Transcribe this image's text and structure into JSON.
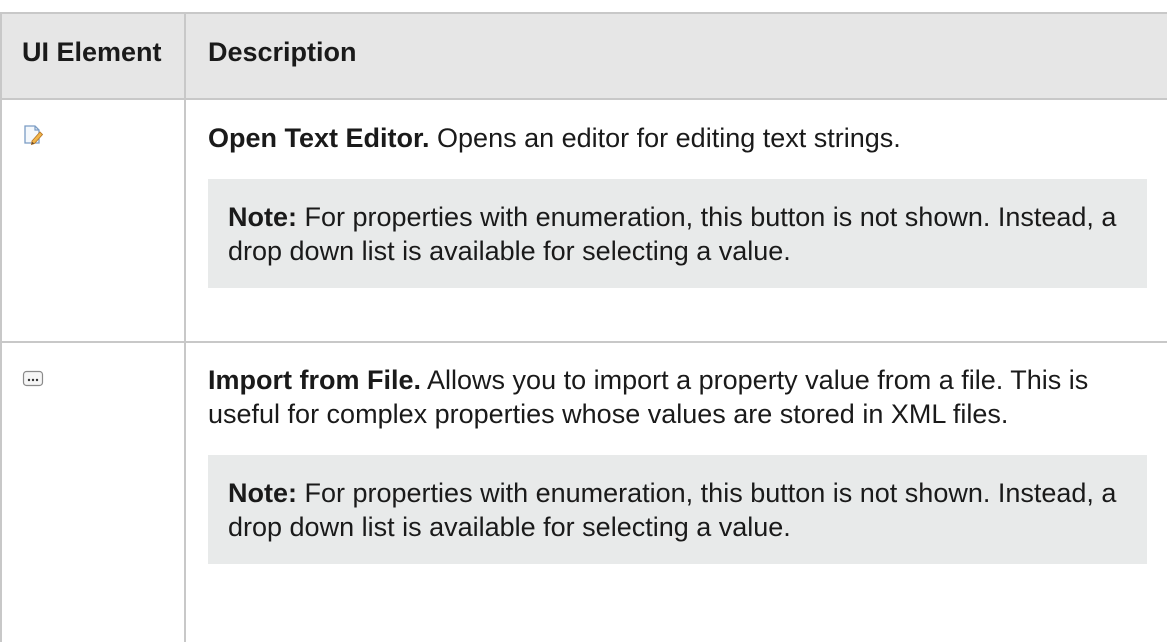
{
  "table": {
    "headers": {
      "ui_element": "UI Element",
      "description": "Description"
    },
    "rows": [
      {
        "icon": "edit-icon",
        "title": "Open Text Editor.",
        "text": " Opens an editor for editing text strings.",
        "note_label": "Note:",
        "note_text": " For properties with enumeration, this button is not shown. Instead, a drop down list is available for selecting a value."
      },
      {
        "icon": "ellipsis-icon",
        "title": "Import from File.",
        "text": " Allows you to import a property value from a file. This is useful for complex properties whose values are stored in XML files.",
        "note_label": "Note:",
        "note_text": " For properties with enumeration, this button is not shown. Instead, a drop down list is available for selecting a value."
      }
    ]
  },
  "colors": {
    "header_bg": "#e6e6e6",
    "note_bg": "#e8eaea",
    "border": "#c8c8c8"
  }
}
